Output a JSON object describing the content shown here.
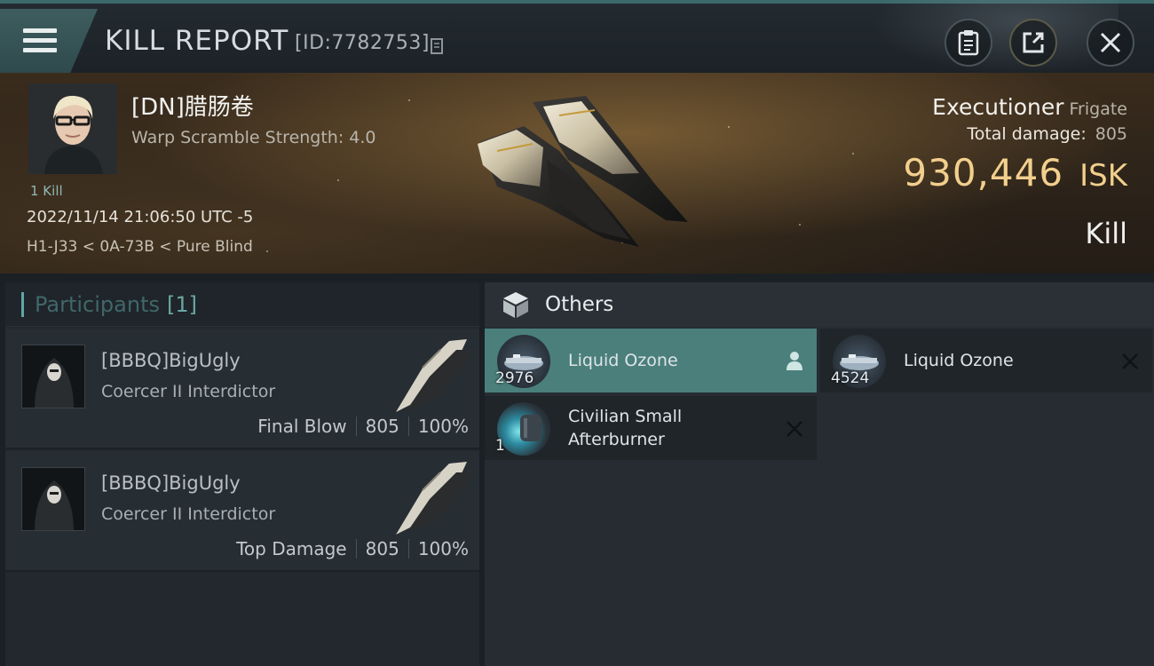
{
  "header": {
    "title": "KILL REPORT",
    "id_text": "[ID:7782753]"
  },
  "victim": {
    "name": "[DN]腊肠卷",
    "sub": "Warp Scramble Strength: 4.0",
    "kill_count": "1 Kill",
    "timestamp": "2022/11/14 21:06:50 UTC -5",
    "location": "H1-J33 < 0A-73B < Pure Blind",
    "ship_name": "Executioner",
    "ship_class": "Frigate",
    "total_damage_label": "Total damage:",
    "total_damage": "805",
    "isk_value": "930,446",
    "isk_unit": "ISK",
    "result": "Kill"
  },
  "participants": {
    "label": "Participants",
    "count": "[1]",
    "rows": [
      {
        "name": "[BBBQ]BigUgly",
        "ship": "Coercer II Interdictor",
        "tag": "Final Blow",
        "damage": "805",
        "percent": "100%"
      },
      {
        "name": "[BBBQ]BigUgly",
        "ship": "Coercer II Interdictor",
        "tag": "Top Damage",
        "damage": "805",
        "percent": "100%"
      }
    ]
  },
  "others": {
    "label": "Others",
    "items": [
      {
        "name": "Liquid Ozone",
        "qty": "2976",
        "state": "dropped",
        "action_icon": "person-icon"
      },
      {
        "name": "Liquid Ozone",
        "qty": "4524",
        "state": "destroyed",
        "action_icon": "close-icon"
      },
      {
        "name": "Civilian Small Afterburner",
        "qty": "1",
        "state": "destroyed",
        "action_icon": "close-icon"
      }
    ]
  },
  "colors": {
    "accent": "#5fa7a6",
    "isk": "#f2cf8d",
    "dropped_bg": "#4a7f7c"
  }
}
